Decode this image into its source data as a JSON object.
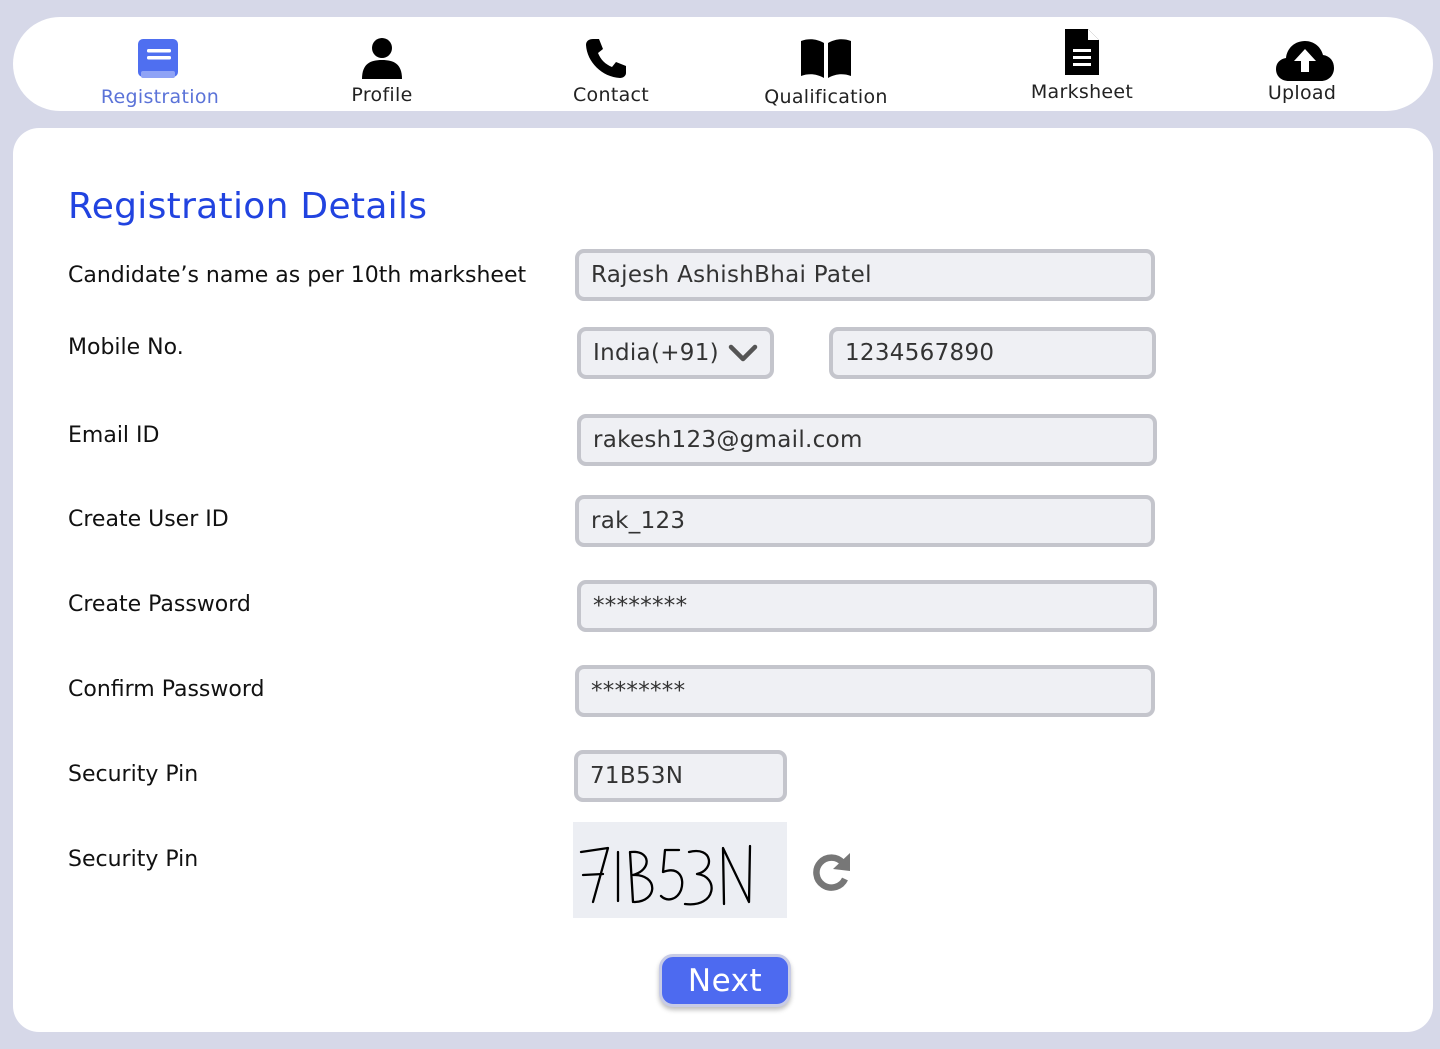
{
  "nav": {
    "items": [
      {
        "label": "Registration",
        "icon": "book-icon",
        "active": true
      },
      {
        "label": "Profile",
        "icon": "user-icon"
      },
      {
        "label": "Contact",
        "icon": "phone-icon"
      },
      {
        "label": "Qualification",
        "icon": "open-book-icon"
      },
      {
        "label": "Marksheet",
        "icon": "document-icon"
      },
      {
        "label": "Upload",
        "icon": "cloud-upload-icon"
      }
    ]
  },
  "form": {
    "title": "Registration Details",
    "name": {
      "label": "Candidate’s name as per 10th marksheet",
      "value": "Rajesh AshishBhai Patel"
    },
    "mobile": {
      "label": "Mobile No.",
      "country": "India(+91)",
      "value": "1234567890"
    },
    "email": {
      "label": "Email ID",
      "value": "rakesh123@gmail.com"
    },
    "user_id": {
      "label": "Create User ID",
      "value": "rak_123"
    },
    "password": {
      "label": "Create  Password",
      "value": "********"
    },
    "confirm_password": {
      "label": "Confirm  Password",
      "value": "********"
    },
    "security_pin_input": {
      "label": "Security Pin",
      "value": "71B53N"
    },
    "security_pin_captcha": {
      "label": "Security Pin",
      "captcha_text": "71B53N"
    },
    "next_label": "Next"
  },
  "colors": {
    "accent": "#4d6af0",
    "active_nav": "#5b73d8",
    "title": "#2143e0",
    "background": "#d6d8e8"
  }
}
